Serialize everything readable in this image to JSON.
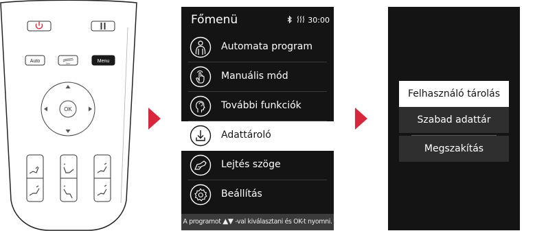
{
  "remote": {
    "power_icon": "power-icon",
    "pause_icon": "pause-icon",
    "auto_label": "Auto",
    "zero_label": "Zero",
    "menu_label": "Menu",
    "ok_label": "OK",
    "colors": {
      "power": "#d8273c",
      "menu_bg": "#1a1a1a"
    }
  },
  "screen1": {
    "title": "Főmenü",
    "status": {
      "bluetooth_icon": "bluetooth-icon",
      "heat_icon": "heat-icon",
      "time": "30:00"
    },
    "items": [
      {
        "label": "Automata program",
        "icon": "person-body-icon",
        "selected": false
      },
      {
        "label": "Manuális mód",
        "icon": "hand-touch-icon",
        "selected": false
      },
      {
        "label": "További funkciók",
        "icon": "head-face-icon",
        "selected": false
      },
      {
        "label": "Adattároló",
        "icon": "download-icon",
        "selected": true
      },
      {
        "label": "Lejtés szöge",
        "icon": "recline-chair-icon",
        "selected": false
      },
      {
        "label": "Beállítás",
        "icon": "settings-gear-icon",
        "selected": false
      }
    ],
    "footer": {
      "pre": "A programot",
      "arrows": "▲▼",
      "post": "-val kiválasztani és OK-t nyomni."
    }
  },
  "screen2": {
    "items": [
      {
        "label": "Felhasználó tárolás",
        "selected": true
      },
      {
        "label": "Szabad adattár",
        "selected": false
      },
      {
        "label": "Megszakítás",
        "selected": false
      }
    ]
  },
  "colors": {
    "arrow": "#d8273c",
    "screen_bg": "#141414",
    "footer_bg": "#3b3b3b"
  }
}
